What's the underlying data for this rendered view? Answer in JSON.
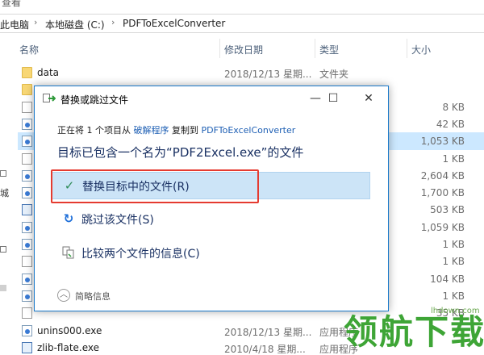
{
  "menu": {
    "view_label": "查看"
  },
  "breadcrumb": {
    "items": [
      "此电脑",
      "本地磁盘 (C:)",
      "PDFToExcelConverter"
    ],
    "sep": "›"
  },
  "nav": {
    "chars": [
      "城"
    ]
  },
  "columns": {
    "name": "名称",
    "date": "修改日期",
    "type": "类型",
    "size": "大小"
  },
  "files": [
    {
      "name": "data",
      "date": "2018/12/13 星期...",
      "type": "文件夹",
      "size": "",
      "icon": "folder-icon"
    },
    {
      "name": "PC",
      "date": "2018/12/13 星期...",
      "type": "文件夹",
      "size": "",
      "icon": "folder-icon"
    },
    {
      "name": "",
      "date": "",
      "type": "",
      "size": "8 KB",
      "icon": "document-icon"
    },
    {
      "name": "",
      "date": "",
      "type": "",
      "size": "42 KB",
      "icon": "settings-file-icon"
    },
    {
      "name": "",
      "date": "",
      "type": "",
      "size": "1,053 KB",
      "icon": "settings-file-icon",
      "selected": true
    },
    {
      "name": "",
      "date": "",
      "type": "",
      "size": "1 KB",
      "icon": "document-icon"
    },
    {
      "name": "",
      "date": "",
      "type": "",
      "size": "2,604 KB",
      "icon": "installer-icon"
    },
    {
      "name": "",
      "date": "",
      "type": "",
      "size": "1,700 KB",
      "icon": "settings-file-icon"
    },
    {
      "name": "",
      "date": "",
      "type": "",
      "size": "503 KB",
      "icon": "app-window-icon"
    },
    {
      "name": "",
      "date": "",
      "type": "",
      "size": "1,059 KB",
      "icon": "settings-file-icon"
    },
    {
      "name": "",
      "date": "",
      "type": "",
      "size": "1 KB",
      "icon": "settings-file-icon"
    },
    {
      "name": "",
      "date": "",
      "type": "",
      "size": "1 KB",
      "icon": "document-icon"
    },
    {
      "name": "",
      "date": "",
      "type": "",
      "size": "104 KB",
      "icon": "globe-file-icon"
    },
    {
      "name": "",
      "date": "",
      "type": "",
      "size": "1 KB",
      "icon": "settings-file-icon"
    },
    {
      "name": "",
      "date": "",
      "type": "",
      "size": "35 KB",
      "icon": "document-icon"
    },
    {
      "name": "unins000.exe",
      "date": "2018/12/13 星期...",
      "type": "应用程序",
      "size": "",
      "icon": "installer-icon"
    },
    {
      "name": "zlib-flate.exe",
      "date": "2010/4/18 星期...",
      "type": "应用程序",
      "size": "",
      "icon": "app-window-icon"
    }
  ],
  "dialog": {
    "title": "替换或跳过文件",
    "copy_prefix": "正在将 1 个项目从",
    "source_link": "破解程序",
    "copy_middle": "复制到",
    "dest_link": "PDFToExcelConverter",
    "headline": "目标已包含一个名为“PDF2Excel.exe”的文件",
    "replace_label": "替换目标中的文件(R)",
    "skip_label": "跳过该文件(S)",
    "compare_label": "比较两个文件的信息(C)",
    "details_label": "简略信息",
    "minimize_glyph": "—",
    "maximize_glyph": "☐",
    "close_glyph": "✕",
    "check_glyph": "✓",
    "skip_glyph": "↻",
    "compare_glyph": "⧉",
    "chevron_glyph": "︿"
  },
  "watermark": {
    "small_text": "lhdown.com",
    "big_text": "领航下载"
  },
  "colors": {
    "accent": "#1979ca",
    "highlight": "#e53b30",
    "selection": "#cce8ff",
    "watermark": "#3ea536"
  }
}
